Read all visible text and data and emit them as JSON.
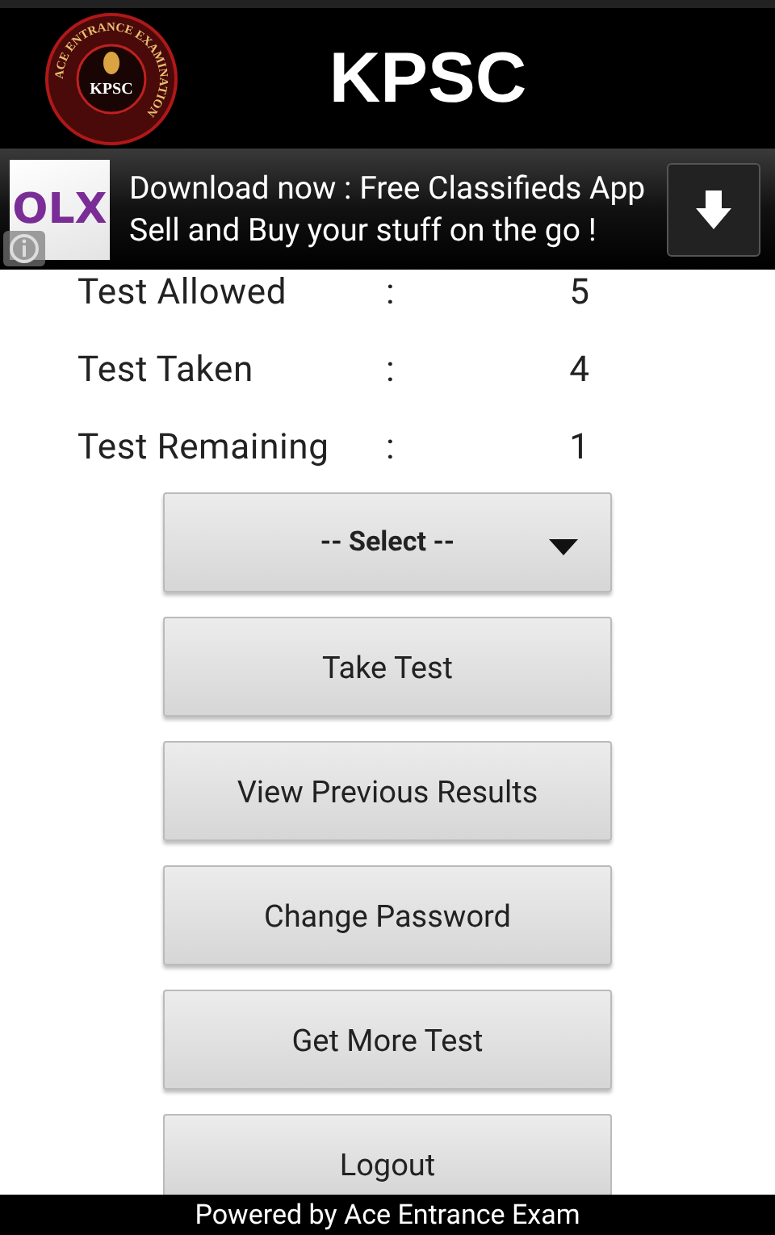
{
  "header": {
    "title": "KPSC",
    "logo": {
      "ring_text": "ACE ENTRANCE EXAMINATION",
      "center_text": "KPSC"
    }
  },
  "ad": {
    "logo_text": "OLX",
    "line_1": "Download now : Free Classifieds App",
    "line_2": "Sell and Buy your stuff on the go !"
  },
  "stats": [
    {
      "label": "Test Allowed",
      "separator": ":",
      "value": "5"
    },
    {
      "label": "Test Taken",
      "separator": ":",
      "value": "4"
    },
    {
      "label": "Test Remaining",
      "separator": ":",
      "value": "1"
    }
  ],
  "dropdown": {
    "value": "-- Select --"
  },
  "buttons": [
    "Take Test",
    "View Previous Results",
    "Change Password",
    "Get More Test",
    "Logout"
  ],
  "footer": "Powered by Ace Entrance Exam"
}
